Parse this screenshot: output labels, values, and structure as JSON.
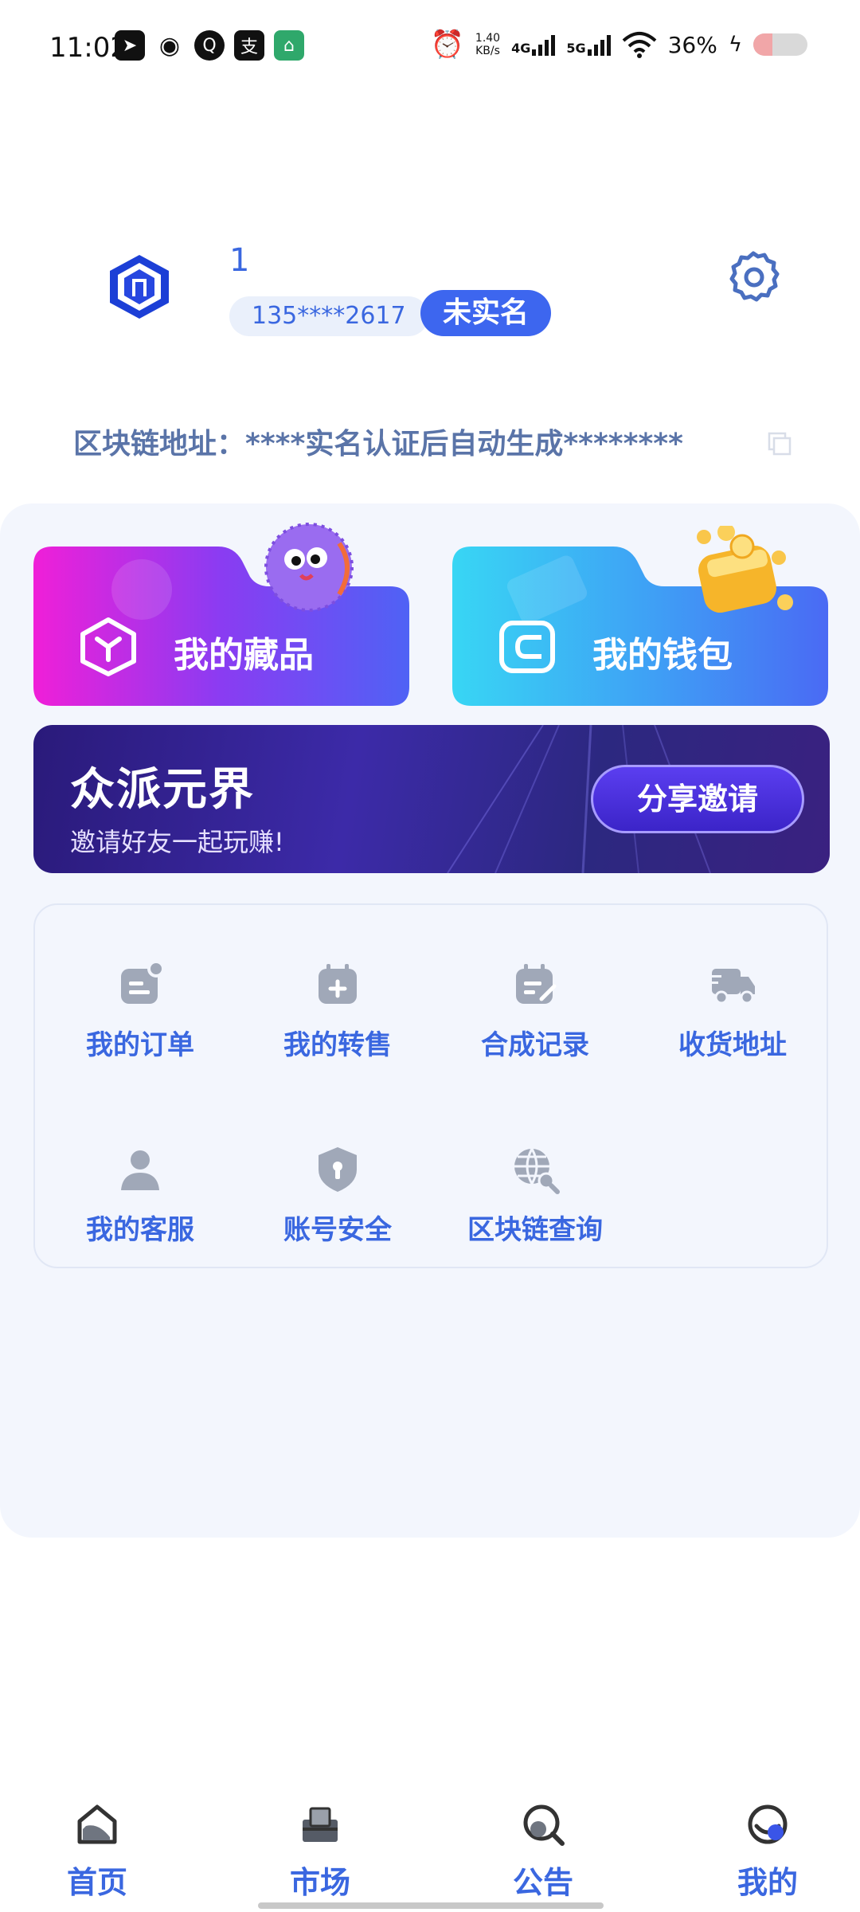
{
  "status_bar": {
    "time": "11:02",
    "net_speed_value": "1.40",
    "net_speed_unit": "KB/s",
    "net1": "4G",
    "net2": "5G",
    "battery_text": "36%",
    "battery_level": 0.36
  },
  "profile": {
    "username": "1",
    "phone": "135****2617",
    "realname_status": "未实名"
  },
  "chain": {
    "label": "区块链地址：",
    "value": "****实名认证后自动生成********"
  },
  "cards": {
    "collection_label": "我的藏品",
    "wallet_label": "我的钱包"
  },
  "banner": {
    "title": "众派元界",
    "subtitle": "邀请好友一起玩赚!",
    "button": "分享邀请"
  },
  "menu": [
    {
      "label": "我的订单",
      "icon": "order-icon"
    },
    {
      "label": "我的转售",
      "icon": "resale-icon"
    },
    {
      "label": "合成记录",
      "icon": "synthesis-record-icon"
    },
    {
      "label": "收货地址",
      "icon": "delivery-truck-icon"
    },
    {
      "label": "我的客服",
      "icon": "customer-service-icon"
    },
    {
      "label": "账号安全",
      "icon": "shield-lock-icon"
    },
    {
      "label": "区块链查询",
      "icon": "globe-search-icon"
    }
  ],
  "nav": [
    {
      "label": "首页",
      "icon": "home-icon"
    },
    {
      "label": "市场",
      "icon": "market-icon"
    },
    {
      "label": "公告",
      "icon": "announcement-icon"
    },
    {
      "label": "我的",
      "icon": "profile-icon"
    }
  ],
  "colors": {
    "accent": "#3a67e0",
    "badge": "#3d66ef",
    "panel_bg": "#f3f6fd"
  }
}
